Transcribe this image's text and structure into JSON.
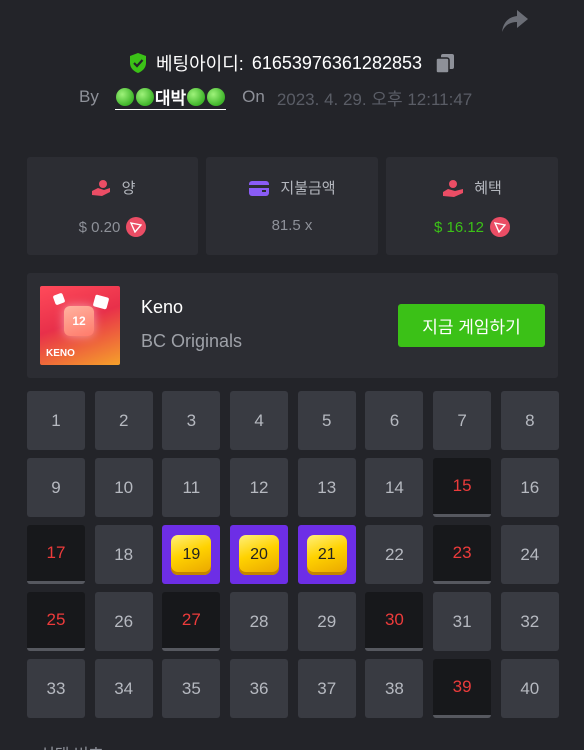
{
  "header": {
    "bet_id_label": "베팅아이디:",
    "bet_id": "61653976361282853",
    "by_label": "By",
    "user_name": "대박",
    "on_label": "On",
    "date": "2023. 4. 29. 오후 12:11:47"
  },
  "stats": [
    {
      "label": "양",
      "value": "$ 0.20",
      "icon": "money-hand-icon",
      "coin": "tron-icon"
    },
    {
      "label": "지불금액",
      "value": "81.5 x",
      "icon": "wallet-icon"
    },
    {
      "label": "혜택",
      "value": "$ 16.12",
      "icon": "user-payout-icon",
      "coin": "tron-icon"
    }
  ],
  "game": {
    "title": "Keno",
    "provider": "BC Originals",
    "thumb_number": "12",
    "thumb_label": "KENO",
    "play_label": "지금 게임하기"
  },
  "grid": {
    "cells": [
      "1",
      "2",
      "3",
      "4",
      "5",
      "6",
      "7",
      "8",
      "9",
      "10",
      "11",
      "12",
      "13",
      "14",
      "15",
      "16",
      "17",
      "18",
      "19",
      "20",
      "21",
      "22",
      "23",
      "24",
      "25",
      "26",
      "27",
      "28",
      "29",
      "30",
      "31",
      "32",
      "33",
      "34",
      "35",
      "36",
      "37",
      "38",
      "39",
      "40"
    ],
    "drawn_misses": [
      "15",
      "17",
      "23",
      "25",
      "27",
      "30",
      "39"
    ],
    "hits": [
      "19",
      "20",
      "21"
    ]
  },
  "footer": {
    "partial_text": "선택 번호"
  },
  "colors": {
    "accent_green": "#3bc117",
    "hit_purple": "#6d2ee6",
    "miss_red": "#ec3b3b",
    "tron_red": "#eb4d65"
  }
}
